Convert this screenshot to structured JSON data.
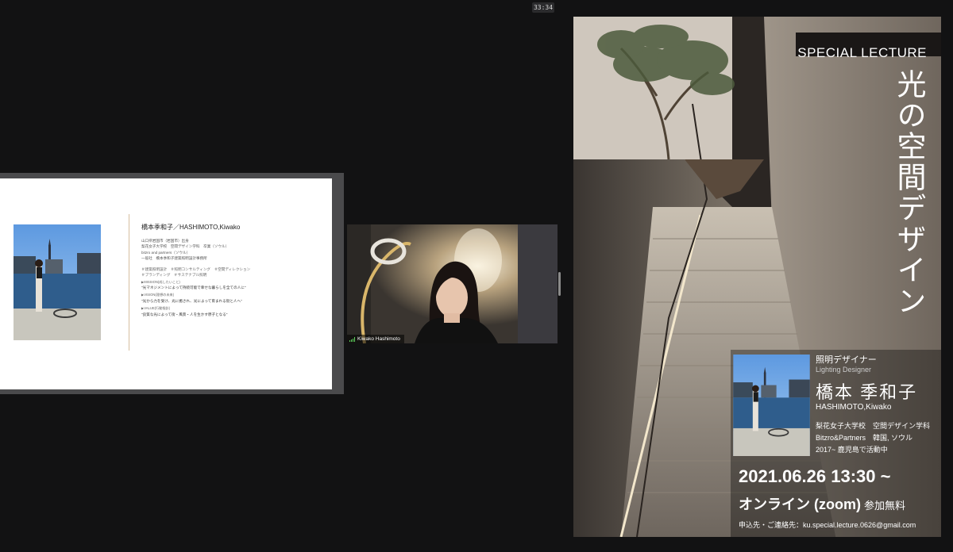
{
  "meeting": {
    "timer": "33:34"
  },
  "slide": {
    "name": "橋本季和子／HASHIMOTO,Kiwako",
    "bio": [
      "山口県岩国市（岩国市）出身",
      "梨花女子大学校　空間デザイン学科　卒業（ソウル）",
      "bitzro and partners（ソウル）",
      "一般社　橋本季和子建築照明設計事務所"
    ],
    "tags": [
      "＃建築照明設計　＃照明コンサルティング　＃空間ディレクション",
      "＃ブランディング　＃サステナブル照明"
    ],
    "mission_heading": "▶MISSION(成したいこと)",
    "mission": "\"光マネジメントによって持続可能で幸せな暮らしを全ての人に\"",
    "vision_heading": "▶VISION(理想の未来)",
    "vision": "\"光から力を受け、光に癒され、光によって育まれる街と人へ\"",
    "value_heading": "▶VALUE(行動指針)",
    "value": "\"良質な光によって街・風景・人を生かす原子となる\""
  },
  "participant": {
    "name": "Kiwako Hashimoto"
  },
  "poster": {
    "tag": "SPECIAL  LECTURE",
    "title": "光の空間デザイン",
    "role_ja": "照明デザイナー",
    "role_en": "Lighting Designer",
    "name_ja": "橋本 季和子",
    "name_en": "HASHIMOTO,Kiwako",
    "cv": [
      "梨花女子大学校　空間デザイン学科",
      "Bitzro&Partners　韓国, ソウル",
      "2017~ 鹿児島で活動中"
    ],
    "date": "2021.06.26 13:30 ~",
    "venue": "オンライン (zoom)",
    "fee": "参加無料",
    "contact": "申込先・ご連絡先：ku.special.lecture.0626@gmail.com"
  },
  "colors": {
    "background": "#131314",
    "signal": "#5dd35d"
  }
}
